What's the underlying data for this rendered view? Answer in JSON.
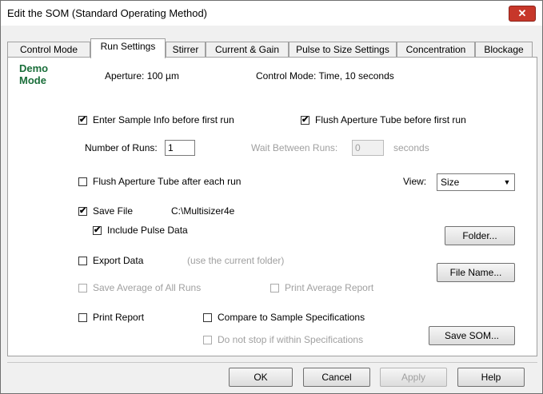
{
  "window": {
    "title": "Edit the SOM (Standard Operating Method)",
    "close_label": "✕"
  },
  "tabs": [
    {
      "label": "Control Mode"
    },
    {
      "label": "Run Settings"
    },
    {
      "label": "Stirrer"
    },
    {
      "label": "Current & Gain"
    },
    {
      "label": "Pulse to Size Settings"
    },
    {
      "label": "Concentration"
    },
    {
      "label": "Blockage"
    }
  ],
  "header": {
    "demo_line1": "Demo",
    "demo_line2": "Mode",
    "aperture": "Aperture:  100  µm",
    "control_mode": "Control Mode:  Time,  10  seconds"
  },
  "options": {
    "enter_sample_info": {
      "label": "Enter Sample Info before first run",
      "checked": "✔"
    },
    "flush_before_first": {
      "label": "Flush Aperture Tube before first run",
      "checked": "✔"
    },
    "number_of_runs_label": "Number of Runs:",
    "number_of_runs_value": "1",
    "wait_between_label": "Wait Between Runs:",
    "wait_between_value": "0",
    "wait_units": "seconds",
    "flush_after_each": {
      "label": "Flush Aperture Tube after each run",
      "checked": ""
    },
    "view_label": "View:",
    "view_value": "Size",
    "save_file": {
      "label": "Save File",
      "checked": "✔"
    },
    "save_path": "C:\\Multisizer4e",
    "include_pulse": {
      "label": "Include Pulse Data",
      "checked": "✔"
    },
    "export_data": {
      "label": "Export Data",
      "checked": ""
    },
    "export_hint": "(use the current folder)",
    "save_average": {
      "label": "Save Average of All Runs",
      "checked": ""
    },
    "print_average": {
      "label": "Print Average Report",
      "checked": ""
    },
    "print_report": {
      "label": "Print Report",
      "checked": ""
    },
    "compare_specs": {
      "label": "Compare to Sample Specifications",
      "checked": ""
    },
    "do_not_stop": {
      "label": "Do not stop if within Specifications",
      "checked": ""
    }
  },
  "buttons": {
    "folder": "Folder...",
    "file_name": "File Name...",
    "save_som": "Save SOM...",
    "ok": "OK",
    "cancel": "Cancel",
    "apply": "Apply",
    "help": "Help"
  }
}
